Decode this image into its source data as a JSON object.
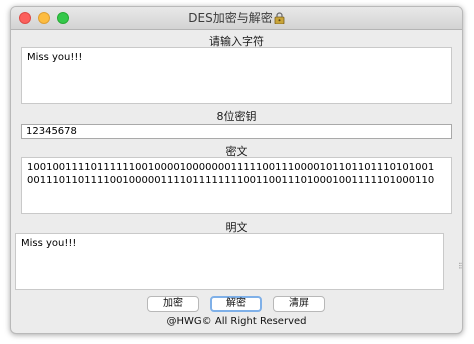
{
  "window": {
    "title": "DES加密与解密",
    "title_icon": "lock-icon"
  },
  "input": {
    "label": "请输入字符",
    "value": "Miss you!!!"
  },
  "key": {
    "label": "8位密钥",
    "value": "12345678"
  },
  "cipher": {
    "label": "密文",
    "value": "1001001111011111100100001000000011111001110000101101101110101001\n0011101101111001000001111011111111001100111010001001111101000110"
  },
  "plain": {
    "label": "明文",
    "value": "Miss you!!!"
  },
  "buttons": {
    "encrypt": "加密",
    "decrypt": "解密",
    "clear": "清屏"
  },
  "footer": {
    "text": "@HWG© All Right Reserved"
  },
  "colors": {
    "close": "#fc605c",
    "minimize": "#fdbc40",
    "zoom": "#34c84a",
    "focus": "#7fb0e8"
  }
}
